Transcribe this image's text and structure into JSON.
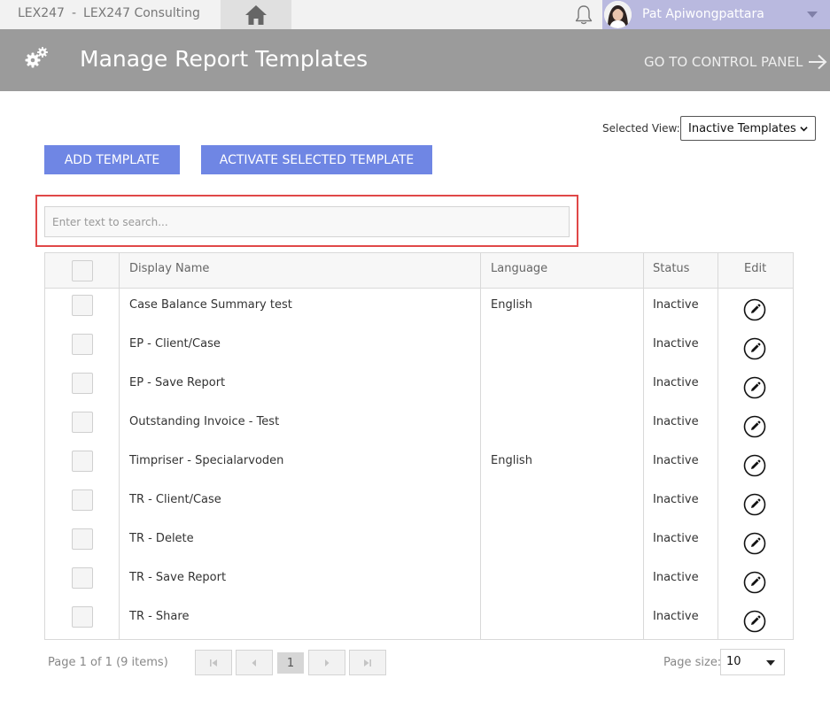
{
  "topbar": {
    "app_name": "LEX247",
    "separator": "-",
    "company": "LEX247 Consulting",
    "home_icon": "home-icon",
    "bell_icon": "bell-icon",
    "user_name": "Pat Apiwongpattara"
  },
  "header": {
    "icon": "gears-icon",
    "title": "Manage Report Templates",
    "control_panel_label": "GO TO CONTROL PANEL"
  },
  "view": {
    "label": "Selected View:",
    "selected": "Inactive Templates"
  },
  "actions": {
    "add_label": "ADD TEMPLATE",
    "activate_label": "ACTIVATE SELECTED TEMPLATE"
  },
  "search": {
    "placeholder": "Enter text to search..."
  },
  "table": {
    "columns": {
      "display_name": "Display Name",
      "language": "Language",
      "status": "Status",
      "edit": "Edit"
    },
    "rows": [
      {
        "name": "Case Balance Summary test",
        "language": "English",
        "status": "Inactive"
      },
      {
        "name": "EP - Client/Case",
        "language": "",
        "status": "Inactive"
      },
      {
        "name": "EP - Save Report",
        "language": "",
        "status": "Inactive"
      },
      {
        "name": "Outstanding Invoice - Test",
        "language": "",
        "status": "Inactive"
      },
      {
        "name": "Timpriser - Specialarvoden",
        "language": "English",
        "status": "Inactive"
      },
      {
        "name": "TR - Client/Case",
        "language": "",
        "status": "Inactive"
      },
      {
        "name": "TR - Delete",
        "language": "",
        "status": "Inactive"
      },
      {
        "name": "TR - Save Report",
        "language": "",
        "status": "Inactive"
      },
      {
        "name": "TR - Share",
        "language": "",
        "status": "Inactive"
      }
    ]
  },
  "pager": {
    "info": "Page 1 of 1 (9 items)",
    "current_page": "1",
    "page_size_label": "Page size:",
    "page_size": "10"
  },
  "colors": {
    "button": "#6f86e4",
    "header": "#9b9b9b",
    "highlight": "#e04848",
    "user_area": "#b9b9df"
  }
}
